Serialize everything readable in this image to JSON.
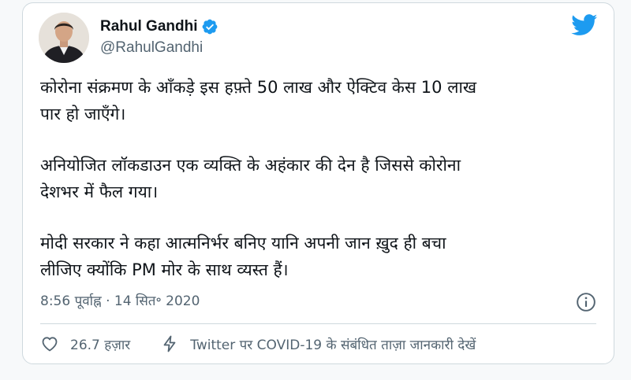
{
  "user": {
    "display_name": "Rahul Gandhi",
    "handle": "@RahulGandhi",
    "verified": true,
    "verified_icon": "verified-badge-icon",
    "brand_icon": "twitter-bird-icon",
    "brand_color": "#1d9bf0"
  },
  "tweet": {
    "paragraphs": [
      "कोरोना संक्रमण के आँकड़े इस हफ़्ते 50 लाख और ऐक्टिव केस 10 लाख\nपार हो जाएँगे।",
      "अनियोजित लॉकडाउन एक व्यक्ति के अहंकार की देन है जिससे कोरोना\nदेशभर में फैल गया।",
      "मोदी सरकार ने कहा आत्मनिर्भर बनिए यानि अपनी जान ख़ुद ही बचा\nलीजिए क्योंकि PM मोर के साथ व्यस्त हैं।"
    ],
    "timestamp": "8:56 पूर्वाह्न · 14 सित॰ 2020"
  },
  "actions": {
    "like_count": "26.7 हज़ार",
    "like_icon": "heart-icon",
    "covid_link": "Twitter पर COVID-19 के संबंधित ताज़ा जानकारी देखें",
    "covid_icon": "lightning-icon",
    "info_icon": "info-icon"
  }
}
